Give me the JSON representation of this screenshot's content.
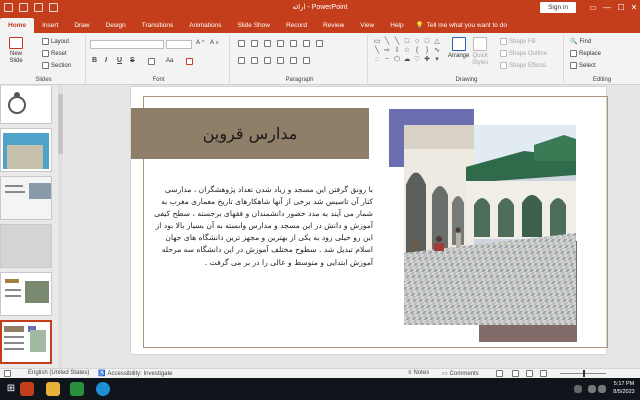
{
  "titlebar": {
    "title": "ارائه - PowerPoint",
    "signin": "Sign in",
    "minimize": "—",
    "maximize": "☐",
    "close": "✕"
  },
  "tabs": [
    "Home",
    "Insert",
    "Draw",
    "Design",
    "Transitions",
    "Animations",
    "Slide Show",
    "Record",
    "Review",
    "View",
    "Help"
  ],
  "tell_me": "Tell me what you want to do",
  "ribbon": {
    "slides": {
      "label": "Slides",
      "new_slide": "New\nSlide",
      "layout": "Layout",
      "reset": "Reset",
      "section": "Section"
    },
    "font": {
      "label": "Font",
      "bold": "B",
      "italic": "I",
      "underline": "U",
      "strike": "S"
    },
    "paragraph": {
      "label": "Paragraph"
    },
    "drawing": {
      "label": "Drawing",
      "arrange": "Arrange",
      "quick_styles": "Quick\nStyles",
      "shape_fill": "Shape Fill",
      "shape_outline": "Shape Outline",
      "shape_effects": "Shape Effects"
    },
    "editing": {
      "label": "Editing",
      "find": "Find",
      "replace": "Replace",
      "select": "Select"
    }
  },
  "slide": {
    "title": "مدارس قروین",
    "body": "با رونق گرفتن این مسجد و زیاد شدن تعداد پژوهشگران ، مدارسی کنار آن تاسیس شد برخی از آنها شاهکارهای تاریخ معماری مغرب به شمار می آیند به مدد حضور دانشمندان و فقهای برجسته ، سطح کیفی آموزش و دانش در این مسجد و مدارس وابسته به آن بسیار بالا بود از این رو خیلی زود به یکی از بهترین و مجهز ترین دانشگاه های جهان اسلام تبدیل شد . سطوح مختلف آموزش در این دانشگاه سه مرحله آموزش ابتدایی و متوسط و عالی را در بر می گرفت ."
  },
  "statusbar": {
    "language": "English (United States)",
    "accessibility": "Accessibility: Investigate",
    "notes": "Notes",
    "comments": "Comments"
  },
  "taskbar": {
    "time": "5:17 PM",
    "date": "8/5/2023"
  },
  "colors": {
    "accent": "#c43e1c",
    "title_box": "#8f7e68",
    "purple_block": "#6b6fb0",
    "brown_block": "#816a68"
  }
}
